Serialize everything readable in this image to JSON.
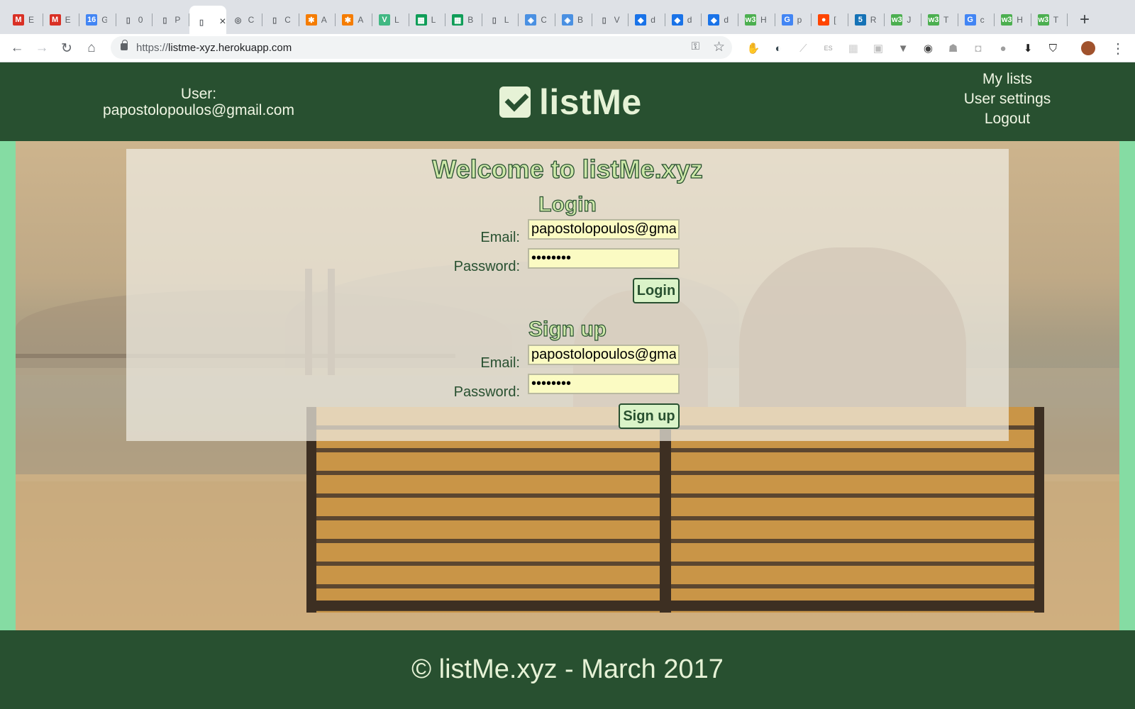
{
  "browser": {
    "tabs": [
      {
        "icon": "gmail-icon",
        "color": "#d93025",
        "glyph": "M",
        "title": "E"
      },
      {
        "icon": "gmail-icon",
        "color": "#d93025",
        "glyph": "M",
        "title": "E"
      },
      {
        "icon": "calendar-icon",
        "color": "#4285f4",
        "glyph": "16",
        "title": "G"
      },
      {
        "icon": "document-icon",
        "color": "#5f6368",
        "glyph": "▯",
        "title": "0"
      },
      {
        "icon": "document-icon",
        "color": "#5f6368",
        "glyph": "▯",
        "title": "P"
      },
      {
        "icon": "document-icon",
        "color": "#5f6368",
        "glyph": "▯",
        "title": "",
        "active": true
      },
      {
        "icon": "aperture-icon",
        "color": "#5f6368",
        "glyph": "◎",
        "title": "C"
      },
      {
        "icon": "document-icon",
        "color": "#5f6368",
        "glyph": "▯",
        "title": "C"
      },
      {
        "icon": "asterisk-icon",
        "color": "#f57c00",
        "glyph": "✱",
        "title": "A"
      },
      {
        "icon": "asterisk-icon",
        "color": "#f57c00",
        "glyph": "✱",
        "title": "A"
      },
      {
        "icon": "vue-icon",
        "color": "#41b883",
        "glyph": "V",
        "title": "L"
      },
      {
        "icon": "sheets-icon",
        "color": "#0f9d58",
        "glyph": "▦",
        "title": "L"
      },
      {
        "icon": "sheets-icon",
        "color": "#0f9d58",
        "glyph": "▦",
        "title": "B"
      },
      {
        "icon": "document-icon",
        "color": "#5f6368",
        "glyph": "▯",
        "title": "L"
      },
      {
        "icon": "shield-icon",
        "color": "#4a90e2",
        "glyph": "◈",
        "title": "C"
      },
      {
        "icon": "shield-icon",
        "color": "#4a90e2",
        "glyph": "◈",
        "title": "B"
      },
      {
        "icon": "document-icon",
        "color": "#5f6368",
        "glyph": "▯",
        "title": "V"
      },
      {
        "icon": "bird-icon",
        "color": "#1a73e8",
        "glyph": "◆",
        "title": "d"
      },
      {
        "icon": "bird-icon",
        "color": "#1a73e8",
        "glyph": "◆",
        "title": "d"
      },
      {
        "icon": "bird-icon",
        "color": "#1a73e8",
        "glyph": "◆",
        "title": "d"
      },
      {
        "icon": "w3-icon",
        "color": "#4caf50",
        "glyph": "w3",
        "title": "H"
      },
      {
        "icon": "google-icon",
        "color": "#4285f4",
        "glyph": "G",
        "title": "p"
      },
      {
        "icon": "reddit-icon",
        "color": "#ff4500",
        "glyph": "●",
        "title": "["
      },
      {
        "icon": "css3-icon",
        "color": "#1572b6",
        "glyph": "5",
        "title": "R"
      },
      {
        "icon": "w3-icon",
        "color": "#4caf50",
        "glyph": "w3",
        "title": "J"
      },
      {
        "icon": "w3-icon",
        "color": "#4caf50",
        "glyph": "w3",
        "title": "T"
      },
      {
        "icon": "google-icon",
        "color": "#4285f4",
        "glyph": "G",
        "title": "c"
      },
      {
        "icon": "w3-icon",
        "color": "#4caf50",
        "glyph": "w3",
        "title": "H"
      },
      {
        "icon": "w3-icon",
        "color": "#4caf50",
        "glyph": "w3",
        "title": "T"
      }
    ],
    "new_tab_glyph": "+",
    "url_scheme": "https://",
    "url_host": "listme-xyz.herokuapp.com",
    "extensions": [
      {
        "name": "adblock-icon",
        "color": "#e53935",
        "glyph": "✋"
      },
      {
        "name": "mask-icon",
        "color": "#37474f",
        "glyph": "◐"
      },
      {
        "name": "feather-icon",
        "color": "#bdbdbd",
        "glyph": "⟋"
      },
      {
        "name": "es-icon",
        "color": "#9e9e9e",
        "glyph": "ES"
      },
      {
        "name": "grid-icon",
        "color": "#cfcfcf",
        "glyph": "▦"
      },
      {
        "name": "box-icon",
        "color": "#bdbdbd",
        "glyph": "▣"
      },
      {
        "name": "vue-devtools-icon",
        "color": "#757575",
        "glyph": "▼"
      },
      {
        "name": "bulb-icon",
        "color": "#424242",
        "glyph": "◉"
      },
      {
        "name": "robot-icon",
        "color": "#9e9e9e",
        "glyph": "☗"
      },
      {
        "name": "car-icon",
        "color": "#bdbdbd",
        "glyph": "◘"
      },
      {
        "name": "circle-icon",
        "color": "#9e9e9e",
        "glyph": "●"
      },
      {
        "name": "download-icon",
        "color": "#212121",
        "glyph": "⬇"
      },
      {
        "name": "shield-outline-icon",
        "color": "#212121",
        "glyph": "⛉"
      },
      {
        "name": "profile-avatar-icon",
        "color": "#a0522d",
        "glyph": "●"
      }
    ]
  },
  "header": {
    "user_label": "User:",
    "user_email": "papostolopoulos@gmail.com",
    "brand": "listMe",
    "nav": [
      "My lists",
      "User settings",
      "Logout"
    ]
  },
  "main": {
    "welcome": "Welcome to listMe.xyz",
    "login": {
      "heading": "Login",
      "email_label": "Email:",
      "email_value": "papostolopoulos@gmail.com",
      "password_label": "Password:",
      "password_value": "••••••••",
      "button": "Login"
    },
    "signup": {
      "heading": "Sign up",
      "email_label": "Email:",
      "email_value": "papostolopoulos@gmail.com",
      "password_label": "Password:",
      "password_value": "••••••••",
      "button": "Sign up"
    }
  },
  "footer": {
    "text": "© listMe.xyz - March 2017"
  },
  "colors": {
    "brand_green": "#285030",
    "side_mint": "#85dca3",
    "input_yellow": "#fbfbc3",
    "button_fill": "#daf3c8"
  }
}
